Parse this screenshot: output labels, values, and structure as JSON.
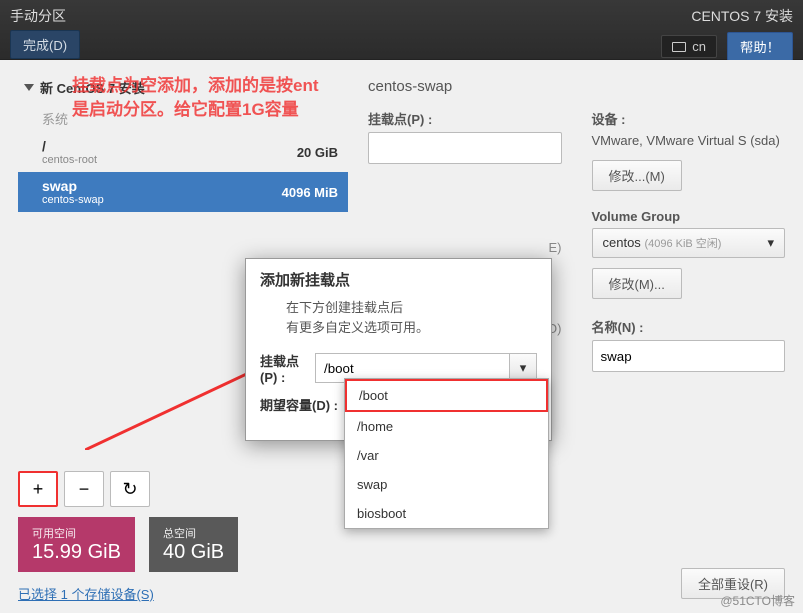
{
  "topbar": {
    "title": "手动分区",
    "done_btn": "完成(D)",
    "install_title": "CENTOS 7 安装",
    "keyboard_layout": "cn",
    "help_btn": "帮助！"
  },
  "annotation": {
    "line1": "挂载点为空添加，添加的是按ent",
    "line2": "是启动分区。给它配置1G容量"
  },
  "left": {
    "section_title": "新 CentOS 7 安装",
    "system_label": "系统",
    "partitions": [
      {
        "mount": "/",
        "device": "centos-root",
        "size": "20 GiB",
        "selected": false
      },
      {
        "mount": "swap",
        "device": "centos-swap",
        "size": "4096 MiB",
        "selected": true
      }
    ],
    "add_btn": "+",
    "remove_btn": "−",
    "reload_btn": "↻",
    "space_available_label": "可用空间",
    "space_available_value": "15.99 GiB",
    "space_total_label": "总空间",
    "space_total_value": "40 GiB",
    "storage_link": "已选择 1 个存储设备(S)"
  },
  "details": {
    "heading": "centos-swap",
    "mountpoint_label": "挂载点(P) :",
    "mountpoint_value": "",
    "device_label": "设备 :",
    "device_text": "VMware, VMware Virtual S (sda)",
    "modify_btn": "修改...(M)",
    "desired_cap_suffix": "E)",
    "devtype_suffix": "(O)",
    "volume_group_label": "Volume Group",
    "vg_name": "centos",
    "vg_free": "(4096 KiB 空闲)",
    "vg_modify": "修改(M)...",
    "name_label": "名称(N) :",
    "name_value": "swap",
    "reset_all": "全部重设(R)"
  },
  "modal": {
    "title": "添加新挂载点",
    "hint_line1": "在下方创建挂载点后",
    "hint_line2": "有更多自定义选项可用。",
    "mount_label": "挂载点(P) :",
    "mount_value": "/boot",
    "capacity_label": "期望容量(D) :",
    "dropdown_options": [
      "/boot",
      "/home",
      "/var",
      "swap",
      "biosboot"
    ]
  },
  "watermark": "@51CTO博客"
}
